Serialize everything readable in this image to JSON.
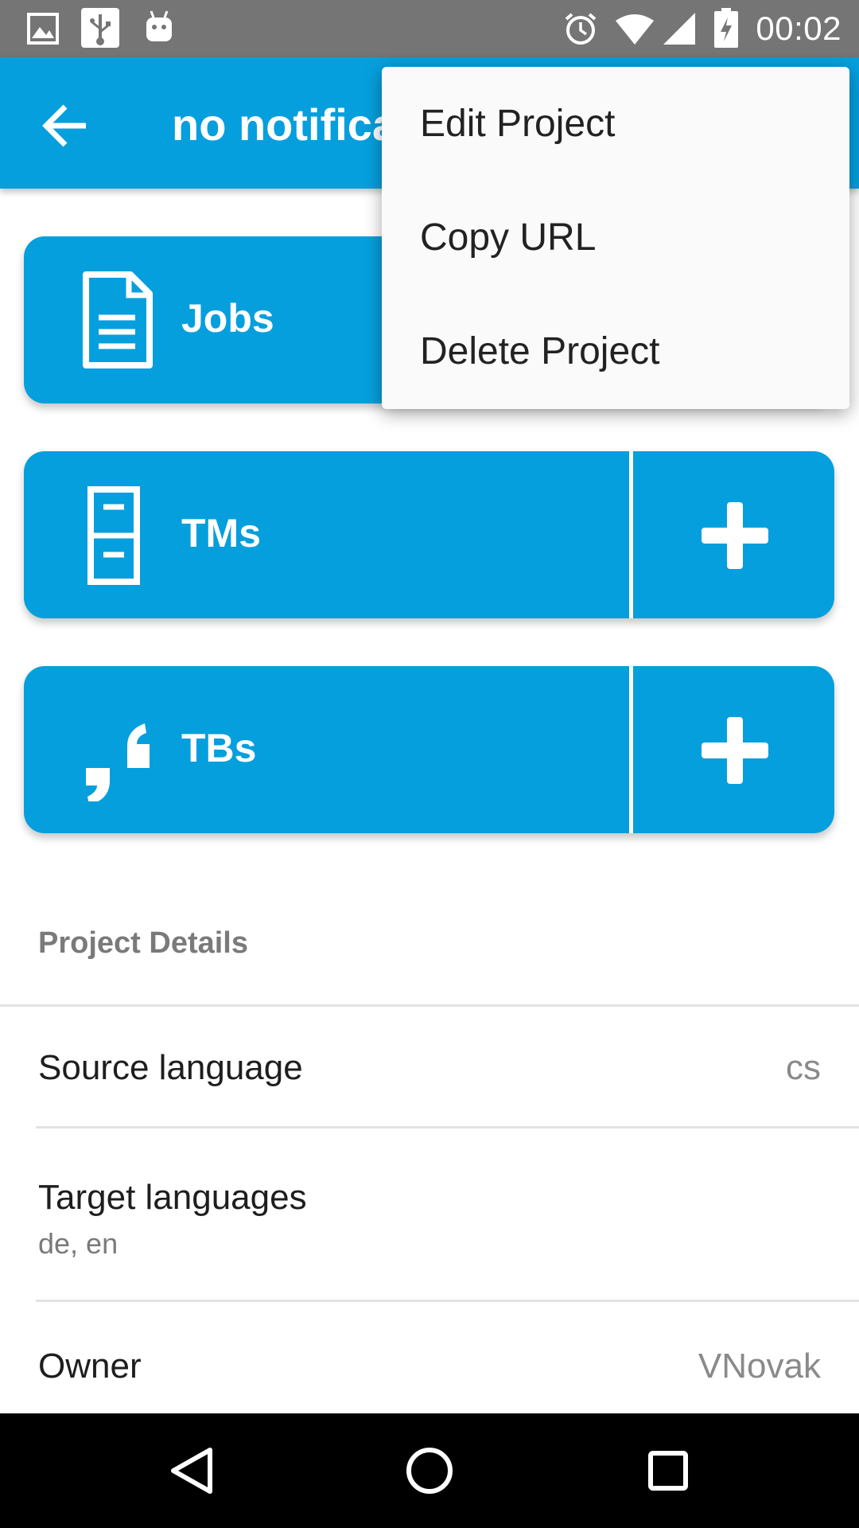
{
  "status_bar": {
    "time": "00:02",
    "left_icons": [
      "image-icon",
      "usb-icon",
      "android-icon"
    ],
    "right_icons": [
      "alarm-icon",
      "wifi-icon",
      "signal-icon",
      "battery-charging-icon"
    ]
  },
  "app_bar": {
    "title": "no notifications",
    "back_icon": "arrow-back-icon",
    "color": "#069fdd"
  },
  "cards": [
    {
      "label": "Jobs",
      "icon": "document-icon"
    },
    {
      "label": "TMs",
      "icon": "file-cabinet-icon",
      "action_icon": "plus-icon"
    },
    {
      "label": "TBs",
      "icon": "quote-icon",
      "action_icon": "plus-icon"
    }
  ],
  "details": {
    "header": "Project Details",
    "source_language": {
      "label": "Source language",
      "value": "cs"
    },
    "target_languages": {
      "label": "Target languages",
      "value": "de, en"
    },
    "owner": {
      "label": "Owner",
      "value": "VNovak"
    }
  },
  "menu": {
    "items": [
      "Edit Project",
      "Copy URL",
      "Delete Project"
    ]
  },
  "nav_bar": {
    "icons": [
      "back-triangle-icon",
      "home-circle-icon",
      "recents-square-icon"
    ]
  }
}
